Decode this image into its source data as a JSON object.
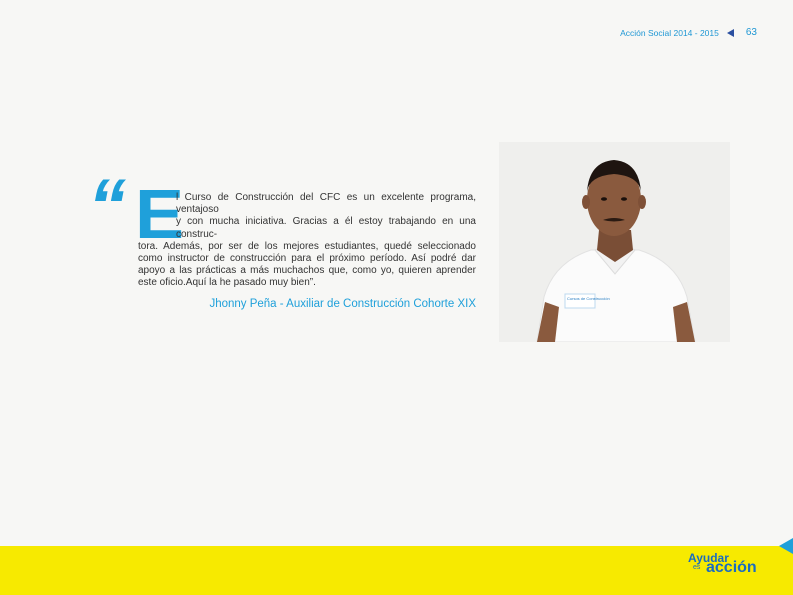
{
  "header": {
    "section": "Acción Social 2014 - 2015",
    "page_number": "63"
  },
  "quote": {
    "mark": "“",
    "dropcap": "E",
    "line1": "l Curso de Construcción del CFC es un excelente programa, ventajoso",
    "line2": "y con mucha iniciativa. Gracias a él estoy trabajando en una construc-",
    "rest": "tora. Además, por ser de los mejores estudiantes, quedé seleccionado como instructor de construcción para el próximo período. Así podré dar apoyo a las prácticas a más muchachos que, como yo, quieren aprender este oficio.Aquí la he pasado muy bien”.",
    "author": "Jhonny Peña - Auxiliar de Construcción Cohorte XIX"
  },
  "photo": {
    "shirt_logo_text": "Cursos de Construcción"
  },
  "footer": {
    "logo_line1": "Ayudar",
    "logo_line2": "es",
    "logo_line3": "acción"
  },
  "colors": {
    "accent_blue": "#1fa0da",
    "footer_yellow": "#f7ea00",
    "logo_blue": "#1a6cc0"
  }
}
